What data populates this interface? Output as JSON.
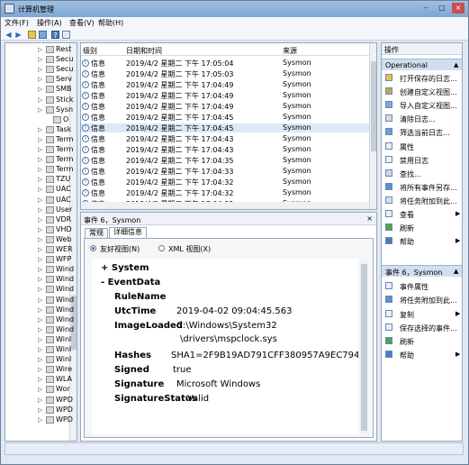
{
  "window": {
    "title": "计算机管理",
    "controls": [
      "–",
      "□",
      "×"
    ]
  },
  "menu": [
    "文件(F)",
    "操作(A)",
    "查看(V)",
    "帮助(H)"
  ],
  "toolbar_icons": [
    "back-icon",
    "forward-icon",
    "up-icon",
    "folder-icon",
    "help-icon",
    "properties-icon"
  ],
  "tree": {
    "items": [
      "Rest",
      "Secu",
      "Secu",
      "Serv",
      "SMB",
      "Stick",
      "Sysn",
      "O",
      "Task",
      "Term",
      "Term",
      "Term",
      "Term",
      "TZU",
      "UAC",
      "UAC",
      "User",
      "VDR",
      "VHD",
      "Web",
      "WER",
      "WFP",
      "Wind",
      "Wind",
      "Wind",
      "Wind",
      "Wind",
      "Wind",
      "Wind",
      "Winl",
      "Winl",
      "Winl",
      "Wire",
      "WLA",
      "Wor",
      "WPD",
      "WPD",
      "WPD"
    ]
  },
  "list": {
    "headers": [
      "级别",
      "日期和时间",
      "来源"
    ],
    "rows": [
      {
        "level": "信息",
        "datetime": "2019/4/2 星期二 下午 17:05:04",
        "source": "Sysmon"
      },
      {
        "level": "信息",
        "datetime": "2019/4/2 星期二 下午 17:05:03",
        "source": "Sysmon"
      },
      {
        "level": "信息",
        "datetime": "2019/4/2 星期二 下午 17:04:49",
        "source": "Sysmon"
      },
      {
        "level": "信息",
        "datetime": "2019/4/2 星期二 下午 17:04:49",
        "source": "Sysmon"
      },
      {
        "level": "信息",
        "datetime": "2019/4/2 星期二 下午 17:04:49",
        "source": "Sysmon"
      },
      {
        "level": "信息",
        "datetime": "2019/4/2 星期二 下午 17:04:45",
        "source": "Sysmon"
      },
      {
        "level": "信息",
        "datetime": "2019/4/2 星期二 下午 17:04:45",
        "source": "Sysmon"
      },
      {
        "level": "信息",
        "datetime": "2019/4/2 星期二 下午 17:04:43",
        "source": "Sysmon"
      },
      {
        "level": "信息",
        "datetime": "2019/4/2 星期二 下午 17:04:43",
        "source": "Sysmon"
      },
      {
        "level": "信息",
        "datetime": "2019/4/2 星期二 下午 17:04:35",
        "source": "Sysmon"
      },
      {
        "level": "信息",
        "datetime": "2019/4/2 星期二 下午 17:04:33",
        "source": "Sysmon"
      },
      {
        "level": "信息",
        "datetime": "2019/4/2 星期二 下午 17:04:32",
        "source": "Sysmon"
      },
      {
        "level": "信息",
        "datetime": "2019/4/2 星期二 下午 17:04:32",
        "source": "Sysmon"
      },
      {
        "level": "信息",
        "datetime": "2019/4/2 星期二 下午 17:04:32",
        "source": "Sysmon"
      }
    ],
    "selected_index": 6
  },
  "details": {
    "title": "事件 6，Sysmon",
    "close": "×",
    "tabs": [
      "常规",
      "详细信息"
    ],
    "active_tab": 1,
    "views": [
      "友好视图(N)",
      "XML 视图(X)"
    ],
    "system_label": "+ System",
    "eventdata_label": "- EventData",
    "fields": [
      {
        "name": "RuleName",
        "value": ""
      },
      {
        "name": "UtcTime",
        "value": "2019-04-02 09:04:45.563"
      },
      {
        "name": "ImageLoaded",
        "value": "C:\\Windows\\System32",
        "value2": "\\drivers\\mspclock.sys"
      },
      {
        "name": "Hashes",
        "value": "SHA1=2F9B19AD791CFF380957A9EC794A"
      },
      {
        "name": "Signed",
        "value": "true"
      },
      {
        "name": "Signature",
        "value": "Microsoft Windows"
      },
      {
        "name": "SignatureStatus",
        "value": "Valid"
      }
    ]
  },
  "actions": {
    "header": "操作",
    "section1": "Operational",
    "items1": [
      "打开保存的日志...",
      "创建自定义视图...",
      "导入自定义视图...",
      "清除日志...",
      "筛选当前日志...",
      "属性",
      "禁用日志",
      "查找...",
      "将所有事件另存...",
      "将任务附加到此...",
      "查看",
      "刷新",
      "帮助"
    ],
    "section2": "事件 6，Sysmon",
    "items2": [
      "事件属性",
      "将任务附加到此...",
      "复制",
      "保存选择的事件...",
      "刷新",
      "帮助"
    ]
  }
}
